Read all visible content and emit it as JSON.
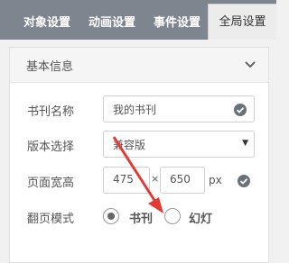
{
  "tabs": [
    {
      "label": "对象设置"
    },
    {
      "label": "动画设置"
    },
    {
      "label": "事件设置"
    },
    {
      "label": "全局设置"
    }
  ],
  "panel": {
    "title": "基本信息",
    "book_name": {
      "label": "书刊名称",
      "value": "我的书刊"
    },
    "version": {
      "label": "版本选择",
      "value": "兼容版"
    },
    "page_size": {
      "label": "页面宽高",
      "width": "475",
      "x": "×",
      "height": "650",
      "unit": "px"
    },
    "flip_mode": {
      "label": "翻页模式",
      "options": [
        "书刊",
        "幻灯"
      ],
      "selected": "书刊"
    }
  },
  "colors": {
    "tabbar": "#7e858f",
    "annotation_arrow": "#e53935"
  },
  "icons": {
    "collapse": "chevron-down-icon",
    "confirm": "check-circle-icon"
  }
}
